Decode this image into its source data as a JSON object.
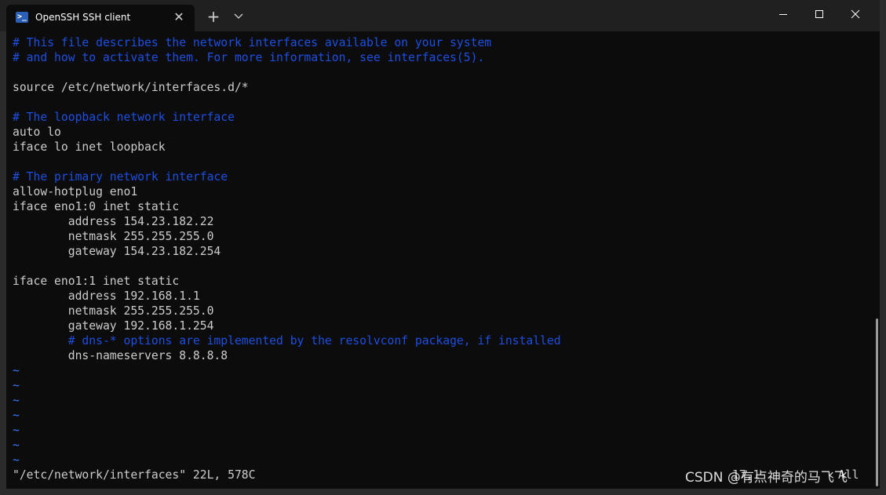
{
  "tab": {
    "title": "OpenSSH SSH client",
    "icon": "powershell-icon",
    "close_glyph": "✕"
  },
  "titlebar": {
    "new_tab_glyph": "+"
  },
  "lines": [
    {
      "text": "# This file describes the network interfaces available on your system",
      "kind": "comment"
    },
    {
      "text": "# and how to activate them. For more information, see interfaces(5).",
      "kind": "comment"
    },
    {
      "text": "",
      "kind": "text"
    },
    {
      "text": "source /etc/network/interfaces.d/*",
      "kind": "text"
    },
    {
      "text": "",
      "kind": "text"
    },
    {
      "text": "# The loopback network interface",
      "kind": "comment"
    },
    {
      "text": "auto lo",
      "kind": "text"
    },
    {
      "text": "iface lo inet loopback",
      "kind": "text"
    },
    {
      "text": "",
      "kind": "text"
    },
    {
      "text": "# The primary network interface",
      "kind": "comment"
    },
    {
      "text": "allow-hotplug eno1",
      "kind": "text"
    },
    {
      "text": "iface eno1:0 inet static",
      "kind": "text"
    },
    {
      "text": "        address 154.23.182.22",
      "kind": "text"
    },
    {
      "text": "        netmask 255.255.255.0",
      "kind": "text"
    },
    {
      "text": "        gateway 154.23.182.254",
      "kind": "text"
    },
    {
      "text": "",
      "kind": "text"
    },
    {
      "text": "iface eno1:1 inet static",
      "kind": "text"
    },
    {
      "text": "        address 192.168.1.1",
      "kind": "text"
    },
    {
      "text": "        netmask 255.255.255.0",
      "kind": "text"
    },
    {
      "text": "        gateway 192.168.1.254",
      "kind": "text"
    },
    {
      "text": "        # dns-* options are implemented by the resolvconf package, if installed",
      "kind": "comment"
    },
    {
      "text": "        dns-nameservers 8.8.8.8",
      "kind": "text"
    },
    {
      "text": "~",
      "kind": "tilde"
    },
    {
      "text": "~",
      "kind": "tilde"
    },
    {
      "text": "~",
      "kind": "tilde"
    },
    {
      "text": "~",
      "kind": "tilde"
    },
    {
      "text": "~",
      "kind": "tilde"
    },
    {
      "text": "~",
      "kind": "tilde"
    },
    {
      "text": "~",
      "kind": "tilde"
    }
  ],
  "status": {
    "message": "\"/etc/network/interfaces\" 22L, 578C",
    "ruler": "17,1",
    "position": "All"
  },
  "watermark": "CSDN @有点神奇的马飞飞",
  "colors": {
    "comment": "#1d4fe0",
    "text": "#cccccc",
    "tilde": "#3b78ff",
    "background": "#0c0c0c"
  }
}
